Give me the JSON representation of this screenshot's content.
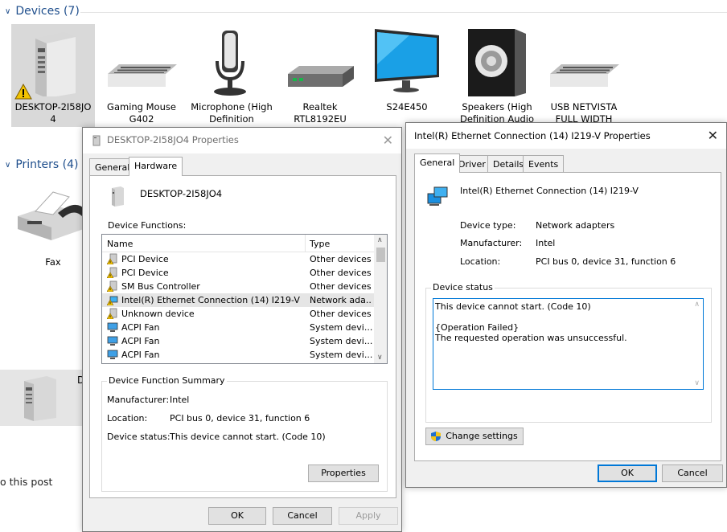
{
  "devices_section": {
    "header": "Devices (7)"
  },
  "devices": [
    {
      "name": "DESKTOP-2I58JO 4",
      "icon": "computer-icon"
    },
    {
      "name": "Gaming Mouse G402",
      "icon": "keyboard-icon"
    },
    {
      "name": "Microphone (High Definition",
      "icon": "microphone-icon"
    },
    {
      "name": "Realtek RTL8192EU",
      "icon": "network-adapter-icon"
    },
    {
      "name": "S24E450",
      "icon": "monitor-icon"
    },
    {
      "name": "Speakers (High Definition Audio",
      "icon": "speaker-icon"
    },
    {
      "name": "USB NETVISTA FULL WIDTH",
      "icon": "keyboard-icon"
    }
  ],
  "printers_section": {
    "header": "Printers (4)"
  },
  "printers": [
    {
      "name": "Fax",
      "icon": "fax-icon"
    }
  ],
  "bottom_device": {
    "label": "D"
  },
  "partial_text": "o this post",
  "desktop_props": {
    "title": "DESKTOP-2I58JO4 Properties",
    "tabs": [
      "General",
      "Hardware"
    ],
    "device_name": "DESKTOP-2I58JO4",
    "functions_label": "Device Functions:",
    "columns": [
      "Name",
      "Type"
    ],
    "rows": [
      {
        "name": "PCI Device",
        "type": "Other devices",
        "icon": "warning-device-icon"
      },
      {
        "name": "PCI Device",
        "type": "Other devices",
        "icon": "warning-device-icon"
      },
      {
        "name": "SM Bus Controller",
        "type": "Other devices",
        "icon": "warning-device-icon"
      },
      {
        "name": "Intel(R) Ethernet Connection (14) I219-V",
        "type": "Network ada...",
        "icon": "warning-network-icon"
      },
      {
        "name": "Unknown device",
        "type": "Other devices",
        "icon": "warning-device-icon"
      },
      {
        "name": "ACPI Fan",
        "type": "System devi...",
        "icon": "system-device-icon"
      },
      {
        "name": "ACPI Fan",
        "type": "System devi...",
        "icon": "system-device-icon"
      },
      {
        "name": "ACPI Fan",
        "type": "System devi...",
        "icon": "system-device-icon"
      }
    ],
    "summary": {
      "title": "Device Function Summary",
      "manufacturer_label": "Manufacturer:",
      "manufacturer": "Intel",
      "location_label": "Location:",
      "location": "PCI bus 0, device 31, function 6",
      "status_label": "Device status:",
      "status": "This device cannot start. (Code 10)"
    },
    "properties_btn": "Properties",
    "ok": "OK",
    "cancel": "Cancel",
    "apply": "Apply"
  },
  "eth_props": {
    "title": "Intel(R) Ethernet Connection (14) I219-V Properties",
    "tabs": [
      "General",
      "Driver",
      "Details",
      "Events"
    ],
    "device_name": "Intel(R) Ethernet Connection (14) I219-V",
    "type_label": "Device type:",
    "type": "Network adapters",
    "manufacturer_label": "Manufacturer:",
    "manufacturer": "Intel",
    "location_label": "Location:",
    "location": "PCI bus 0, device 31, function 6",
    "status_group": "Device status",
    "status_line1": "This device cannot start. (Code 10)",
    "status_line2": "{Operation Failed}",
    "status_line3": "The requested operation was unsuccessful.",
    "change_settings": "Change settings",
    "ok": "OK",
    "cancel": "Cancel"
  },
  "colors": {
    "accent": "#0078d7",
    "header_blue": "#1e4e8c",
    "selection": "#cce8ff"
  }
}
